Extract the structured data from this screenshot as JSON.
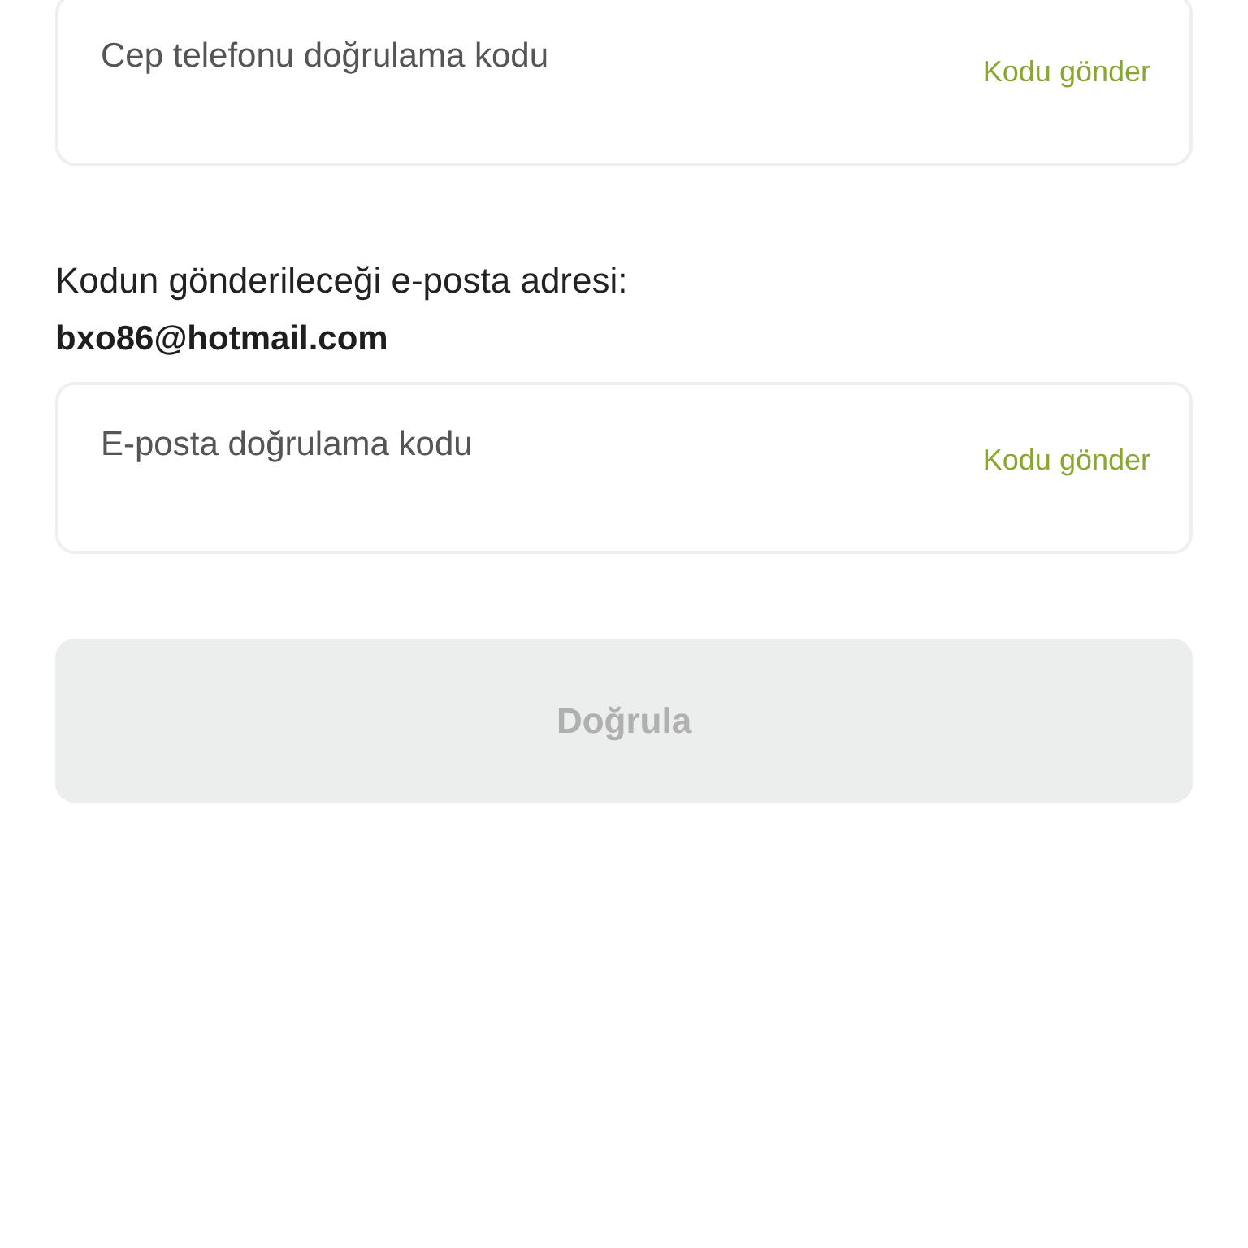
{
  "phone_code": {
    "placeholder": "Cep telefonu doğrulama kodu",
    "send_button": "Kodu gönder"
  },
  "email_notice": {
    "label": "Kodun gönderileceği e-posta adresi:",
    "email": "bxo86@hotmail.com"
  },
  "email_code": {
    "placeholder": "E-posta doğrulama kodu",
    "send_button": "Kodu gönder"
  },
  "verify_button": {
    "label": "Doğrula",
    "disabled": true
  }
}
